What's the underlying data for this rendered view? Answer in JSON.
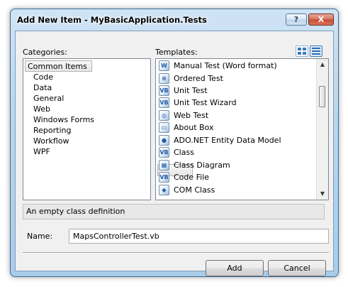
{
  "window": {
    "title": "Add New Item - MyBasicApplication.Tests",
    "help_label": "?",
    "close_label": "X"
  },
  "categories": {
    "label": "Categories:",
    "items": [
      "Common Items",
      "Code",
      "Data",
      "General",
      "Web",
      "Windows Forms",
      "Reporting",
      "Workflow",
      "WPF"
    ],
    "selected": "Common Items"
  },
  "templates": {
    "label": "Templates:",
    "items": [
      {
        "label": "Manual Test (Word format)",
        "icon": "manual-test-icon"
      },
      {
        "label": "Ordered Test",
        "icon": "ordered-test-icon"
      },
      {
        "label": "Unit Test",
        "icon": "unit-test-icon"
      },
      {
        "label": "Unit Test Wizard",
        "icon": "unit-test-wizard-icon"
      },
      {
        "label": "Web Test",
        "icon": "web-test-icon"
      },
      {
        "label": "About Box",
        "icon": "about-box-icon"
      },
      {
        "label": "ADO.NET Entity Data Model",
        "icon": "entity-data-model-icon"
      },
      {
        "label": "Class",
        "icon": "class-icon"
      },
      {
        "label": "Class Diagram",
        "icon": "class-diagram-icon"
      },
      {
        "label": "Code File",
        "icon": "code-file-icon"
      },
      {
        "label": "COM Class",
        "icon": "com-class-icon"
      }
    ],
    "selected": "Class"
  },
  "description": "An empty class definition",
  "name_field": {
    "label": "Name:",
    "value": "MapsControllerTest.vb"
  },
  "buttons": {
    "add": "Add",
    "cancel": "Cancel"
  },
  "colors": {
    "frame": "#a9cce9",
    "close": "#c84a30"
  }
}
